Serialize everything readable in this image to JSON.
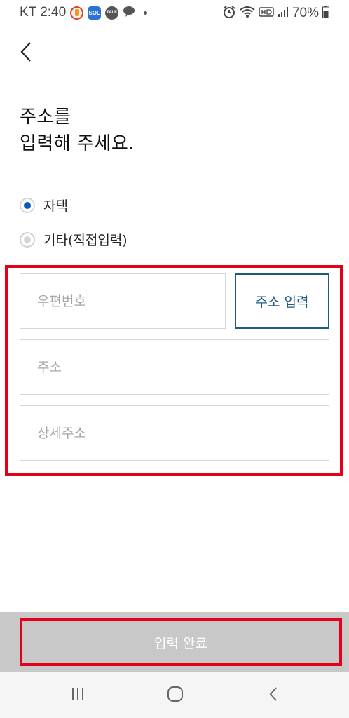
{
  "status_bar": {
    "carrier_time": "KT 2:40",
    "battery": "70%",
    "app_icons": [
      "alarm-app-icon",
      "sol-app-icon",
      "kakaotalk-icon",
      "messenger-icon"
    ],
    "sol_label": "SOL",
    "talk_label": "TALK"
  },
  "header": {
    "title": "주소를\n입력해 주세요."
  },
  "address_type": {
    "selected": "자택",
    "options": [
      {
        "label": "자택",
        "checked": true
      },
      {
        "label": "기타(직접입력)",
        "checked": false
      }
    ]
  },
  "form": {
    "postal_code_placeholder": "우편번호",
    "address_search_button": "주소 입력",
    "address_placeholder": "주소",
    "detail_address_placeholder": "상세주소"
  },
  "footer": {
    "submit_label": "입력 완료"
  },
  "colors": {
    "accent_blue": "#0a5bbd",
    "button_border": "#1d5a7c",
    "highlight_red": "#e2001a",
    "disabled_gray": "#c8c8c8"
  }
}
